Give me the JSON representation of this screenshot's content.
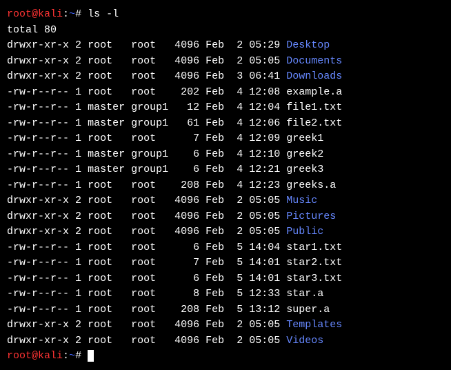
{
  "prompt": {
    "user": "root",
    "at": "@",
    "host": "kali",
    "colon": ":",
    "path": "~",
    "hash": "#"
  },
  "command1": "ls -l",
  "total": "total 80",
  "rows": [
    {
      "perms": "drwxr-xr-x",
      "links": "2",
      "owner": "root  ",
      "group": "root  ",
      "size": "4096",
      "month": "Feb",
      "day": " 2",
      "time": "05:29",
      "name": "Desktop",
      "isDir": true
    },
    {
      "perms": "drwxr-xr-x",
      "links": "2",
      "owner": "root  ",
      "group": "root  ",
      "size": "4096",
      "month": "Feb",
      "day": " 2",
      "time": "05:05",
      "name": "Documents",
      "isDir": true
    },
    {
      "perms": "drwxr-xr-x",
      "links": "2",
      "owner": "root  ",
      "group": "root  ",
      "size": "4096",
      "month": "Feb",
      "day": " 3",
      "time": "06:41",
      "name": "Downloads",
      "isDir": true
    },
    {
      "perms": "-rw-r--r--",
      "links": "1",
      "owner": "root  ",
      "group": "root  ",
      "size": " 202",
      "month": "Feb",
      "day": " 4",
      "time": "12:08",
      "name": "example.a",
      "isDir": false
    },
    {
      "perms": "-rw-r--r--",
      "links": "1",
      "owner": "master",
      "group": "group1",
      "size": "  12",
      "month": "Feb",
      "day": " 4",
      "time": "12:04",
      "name": "file1.txt",
      "isDir": false
    },
    {
      "perms": "-rw-r--r--",
      "links": "1",
      "owner": "master",
      "group": "group1",
      "size": "  61",
      "month": "Feb",
      "day": " 4",
      "time": "12:06",
      "name": "file2.txt",
      "isDir": false
    },
    {
      "perms": "-rw-r--r--",
      "links": "1",
      "owner": "root  ",
      "group": "root  ",
      "size": "   7",
      "month": "Feb",
      "day": " 4",
      "time": "12:09",
      "name": "greek1",
      "isDir": false
    },
    {
      "perms": "-rw-r--r--",
      "links": "1",
      "owner": "master",
      "group": "group1",
      "size": "   6",
      "month": "Feb",
      "day": " 4",
      "time": "12:10",
      "name": "greek2",
      "isDir": false
    },
    {
      "perms": "-rw-r--r--",
      "links": "1",
      "owner": "master",
      "group": "group1",
      "size": "   6",
      "month": "Feb",
      "day": " 4",
      "time": "12:21",
      "name": "greek3",
      "isDir": false
    },
    {
      "perms": "-rw-r--r--",
      "links": "1",
      "owner": "root  ",
      "group": "root  ",
      "size": " 208",
      "month": "Feb",
      "day": " 4",
      "time": "12:23",
      "name": "greeks.a",
      "isDir": false
    },
    {
      "perms": "drwxr-xr-x",
      "links": "2",
      "owner": "root  ",
      "group": "root  ",
      "size": "4096",
      "month": "Feb",
      "day": " 2",
      "time": "05:05",
      "name": "Music",
      "isDir": true
    },
    {
      "perms": "drwxr-xr-x",
      "links": "2",
      "owner": "root  ",
      "group": "root  ",
      "size": "4096",
      "month": "Feb",
      "day": " 2",
      "time": "05:05",
      "name": "Pictures",
      "isDir": true
    },
    {
      "perms": "drwxr-xr-x",
      "links": "2",
      "owner": "root  ",
      "group": "root  ",
      "size": "4096",
      "month": "Feb",
      "day": " 2",
      "time": "05:05",
      "name": "Public",
      "isDir": true
    },
    {
      "perms": "-rw-r--r--",
      "links": "1",
      "owner": "root  ",
      "group": "root  ",
      "size": "   6",
      "month": "Feb",
      "day": " 5",
      "time": "14:04",
      "name": "star1.txt",
      "isDir": false
    },
    {
      "perms": "-rw-r--r--",
      "links": "1",
      "owner": "root  ",
      "group": "root  ",
      "size": "   7",
      "month": "Feb",
      "day": " 5",
      "time": "14:01",
      "name": "star2.txt",
      "isDir": false
    },
    {
      "perms": "-rw-r--r--",
      "links": "1",
      "owner": "root  ",
      "group": "root  ",
      "size": "   6",
      "month": "Feb",
      "day": " 5",
      "time": "14:01",
      "name": "star3.txt",
      "isDir": false
    },
    {
      "perms": "-rw-r--r--",
      "links": "1",
      "owner": "root  ",
      "group": "root  ",
      "size": "   8",
      "month": "Feb",
      "day": " 5",
      "time": "12:33",
      "name": "star.a",
      "isDir": false
    },
    {
      "perms": "-rw-r--r--",
      "links": "1",
      "owner": "root  ",
      "group": "root  ",
      "size": " 208",
      "month": "Feb",
      "day": " 5",
      "time": "13:12",
      "name": "super.a",
      "isDir": false
    },
    {
      "perms": "drwxr-xr-x",
      "links": "2",
      "owner": "root  ",
      "group": "root  ",
      "size": "4096",
      "month": "Feb",
      "day": " 2",
      "time": "05:05",
      "name": "Templates",
      "isDir": true
    },
    {
      "perms": "drwxr-xr-x",
      "links": "2",
      "owner": "root  ",
      "group": "root  ",
      "size": "4096",
      "month": "Feb",
      "day": " 2",
      "time": "05:05",
      "name": "Videos",
      "isDir": true
    }
  ]
}
